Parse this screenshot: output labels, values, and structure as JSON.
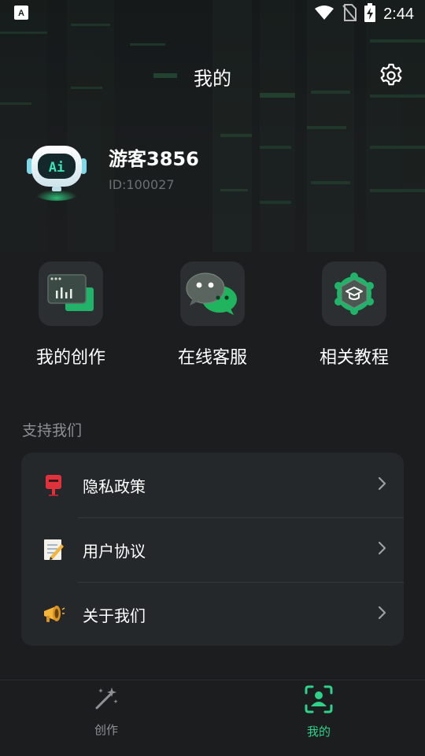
{
  "status_bar": {
    "time": "2:44",
    "notification_icon": "a-icon",
    "wifi_icon": "wifi-icon",
    "signal_icon": "no-sim-icon",
    "battery_icon": "battery-charging-icon"
  },
  "header": {
    "title": "我的",
    "settings_icon": "gear-icon"
  },
  "profile": {
    "name": "游客3856",
    "id": "ID:100027",
    "avatar": "robot-ai-avatar"
  },
  "shortcuts": [
    {
      "label": "我的创作",
      "icon": "creation-chart-icon"
    },
    {
      "label": "在线客服",
      "icon": "wechat-chat-icon"
    },
    {
      "label": "相关教程",
      "icon": "graduation-cap-icon"
    }
  ],
  "support": {
    "title": "支持我们",
    "items": [
      {
        "label": "隐私政策",
        "icon": "postbox-icon"
      },
      {
        "label": "用户协议",
        "icon": "memo-icon"
      },
      {
        "label": "关于我们",
        "icon": "megaphone-icon"
      }
    ]
  },
  "tabbar": {
    "tabs": [
      {
        "label": "创作",
        "icon": "magic-wand-icon",
        "active": false
      },
      {
        "label": "我的",
        "icon": "user-scan-icon",
        "active": true
      }
    ]
  },
  "colors": {
    "accent": "#2fd28a",
    "background": "#1b1d1f",
    "card": "#25282a",
    "tile": "#2b2f31",
    "muted_text": "#8c9093"
  }
}
